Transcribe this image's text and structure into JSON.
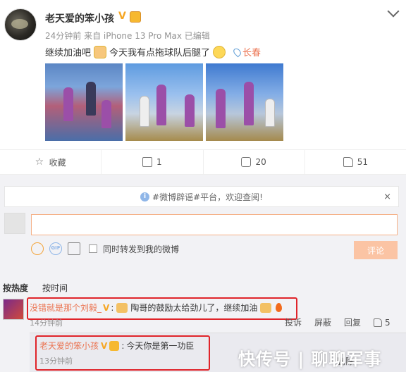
{
  "post": {
    "username": "老天爱的笨小孩",
    "verified_mark": "V",
    "meta": "24分钟前 来自 iPhone 13 Pro Max  已编辑",
    "text_a": "继续加油吧",
    "text_b": "今天我有点拖球队后腿了",
    "location": "长春",
    "images": [
      "basketball-photo-1",
      "basketball-photo-2",
      "basketball-photo-3"
    ]
  },
  "actions": {
    "favorite": "收藏",
    "forward_count": "1",
    "comment_count": "20",
    "like_count": "51"
  },
  "notice": {
    "text": "#微博辟谣#平台，欢迎查阅!",
    "close": "×"
  },
  "composer": {
    "placeholder": "",
    "forward_label": "同时转发到我的微博",
    "submit_label": "评论"
  },
  "sort": {
    "hot": "按热度",
    "time": "按时间"
  },
  "comment1": {
    "name": "没错就是那个刘毅_",
    "text": "陶哥的鼓励太给劲儿了，继续加油",
    "time": "14分钟前",
    "report": "投诉",
    "block": "屏蔽",
    "reply": "回复",
    "likes": "5"
  },
  "reply1": {
    "name": "老天爱的笨小孩",
    "text": "今天你是第一功臣",
    "time": "13分钟前",
    "delete": "删除"
  },
  "watermark": "快传号 | 聊聊军事",
  "colors": {
    "accent": "#eb7350",
    "highlight_border": "#e0242a",
    "verified": "#f5a623"
  }
}
